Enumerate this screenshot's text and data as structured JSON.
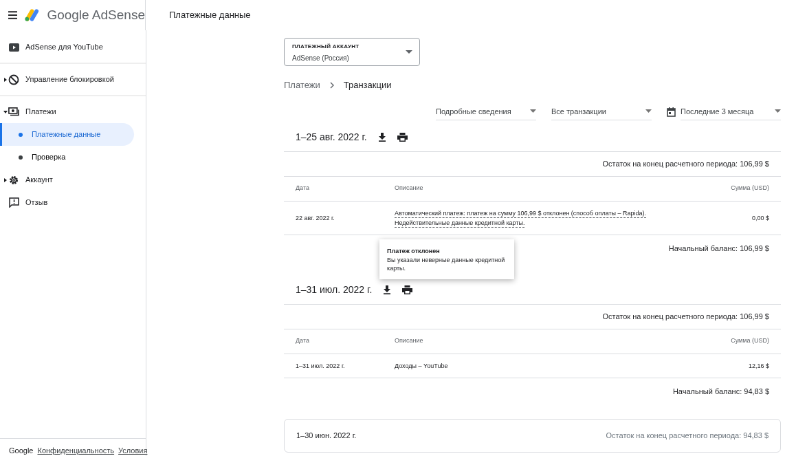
{
  "header": {
    "brand": "Google AdSense",
    "page_title": "Платежные данные"
  },
  "sidebar": {
    "items": [
      {
        "kind": "link",
        "label": "AdSense для YouTube",
        "divider_after": true
      },
      {
        "kind": "group",
        "label": "Управление блокировкой",
        "expanded": false,
        "divider_after": true
      },
      {
        "kind": "group",
        "label": "Платежи",
        "expanded": true,
        "children": [
          {
            "label": "Платежные данные",
            "selected": true
          },
          {
            "label": "Проверка",
            "selected": false
          }
        ]
      },
      {
        "kind": "group",
        "label": "Аккаунт",
        "expanded": false
      },
      {
        "kind": "link",
        "label": "Отзыв"
      }
    ],
    "footer": [
      {
        "label": "Google",
        "link": false
      },
      {
        "label": "Конфиденциальность",
        "link": true
      },
      {
        "label": "Условия",
        "link": true
      }
    ]
  },
  "account_select": {
    "label": "ПЛАТЕЖНЫЙ АККАУНТ",
    "value": "AdSense (Россия)"
  },
  "breadcrumb": [
    "Платежи",
    "Транзакции"
  ],
  "filters": [
    {
      "value": "Подробные сведения",
      "icon": false
    },
    {
      "value": "Все транзакции",
      "icon": false
    },
    {
      "value": "Последние 3 месяца",
      "icon": true
    }
  ],
  "periods": [
    {
      "title": "1–25 авг. 2022 г.",
      "expanded": true,
      "end_balance": "Остаток на конец расчетного периода: 106,99 $",
      "columns": [
        "Дата",
        "Описание",
        "Сумма (USD)"
      ],
      "rows": [
        {
          "date": "22 авг. 2022 г.",
          "description": [
            "Автоматический платеж: платеж на сумму 106,99 $ отклонен (способ оплаты – Rapida).",
            "Недействительные данные кредитной карты."
          ],
          "amount": "0,00 $",
          "has_tooltip": true
        }
      ],
      "start_balance": "Начальный баланс: 106,99 $"
    },
    {
      "title": "1–31 июл. 2022 г.",
      "expanded": true,
      "end_balance": "Остаток на конец расчетного периода: 106,99 $",
      "columns": [
        "Дата",
        "Описание",
        "Сумма (USD)"
      ],
      "rows": [
        {
          "date": "1–31 июл. 2022 г.",
          "description": [
            "Доходы – YouTube"
          ],
          "amount": "12,16 $",
          "has_tooltip": false
        }
      ],
      "start_balance": "Начальный баланс: 94,83 $"
    },
    {
      "title": "1–30 июн. 2022 г.",
      "expanded": false,
      "end_balance": "Остаток на конец расчетного периода: 94,83 $"
    }
  ],
  "tooltip": {
    "title": "Платеж отклонен",
    "text": "Вы указали неверные данные кредитной карты."
  }
}
